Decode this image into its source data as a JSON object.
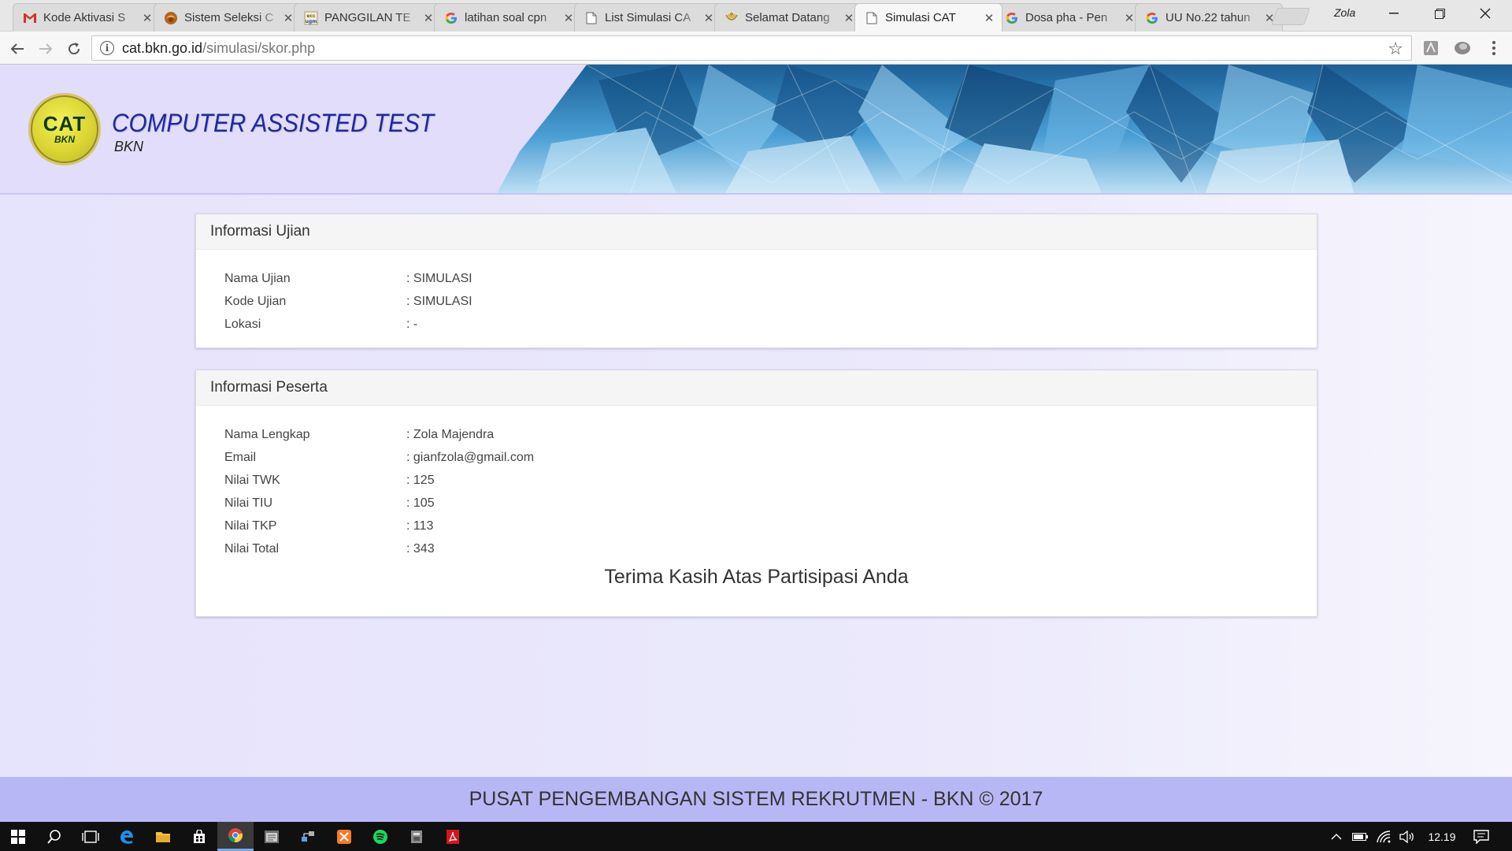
{
  "browser": {
    "tabs": [
      {
        "title": "Kode Aktivasi S",
        "icon": "gmail-icon",
        "active": false
      },
      {
        "title": "Sistem Seleksi C",
        "icon": "garuda-icon",
        "active": false
      },
      {
        "title": "PANGGILAN TE",
        "icon": "ugm-icon",
        "active": false
      },
      {
        "title": "latihan soal cpn",
        "icon": "google-icon",
        "active": false
      },
      {
        "title": "List Simulasi CA",
        "icon": "page-icon",
        "active": false
      },
      {
        "title": "Selamat Datang",
        "icon": "bkn-icon",
        "active": false
      },
      {
        "title": "Simulasi CAT",
        "icon": "page-icon",
        "active": true
      },
      {
        "title": "Dosa pha - Pen",
        "icon": "google-icon",
        "active": false
      },
      {
        "title": "UU No.22 tahun",
        "icon": "google-icon",
        "active": false
      }
    ],
    "profile_name": "Zola",
    "url_domain": "cat.bkn.go.id",
    "url_path": "/simulasi/skor.php"
  },
  "header": {
    "logo_text": "CAT",
    "logo_subtext": "BKN",
    "title": "COMPUTER ASSISTED TEST",
    "subtitle": "BKN"
  },
  "exam_info": {
    "heading": "Informasi Ujian",
    "rows": [
      {
        "label": "Nama Ujian",
        "value": ": SIMULASI"
      },
      {
        "label": "Kode Ujian",
        "value": ": SIMULASI"
      },
      {
        "label": "Lokasi",
        "value": ": -"
      }
    ]
  },
  "participant_info": {
    "heading": "Informasi Peserta",
    "rows": [
      {
        "label": "Nama Lengkap",
        "value": ": Zola Majendra"
      },
      {
        "label": "Email",
        "value": ": gianfzola@gmail.com"
      },
      {
        "label": "Nilai TWK",
        "value": ": 125"
      },
      {
        "label": "Nilai TIU",
        "value": ": 105"
      },
      {
        "label": "Nilai TKP",
        "value": ": 113"
      },
      {
        "label": "Nilai Total",
        "value": ": 343"
      }
    ],
    "thanks": "Terima Kasih Atas Partisipasi Anda"
  },
  "footer": {
    "text": "PUSAT PENGEMBANGAN SISTEM REKRUTMEN - BKN © 2017"
  },
  "taskbar": {
    "clock": "12.19",
    "apps": [
      "start-icon",
      "search-icon",
      "task-view-icon",
      "edge-icon",
      "file-explorer-icon",
      "store-icon",
      "chrome-icon",
      "notepad-icon",
      "network-tool-icon",
      "xampp-icon",
      "spotify-icon",
      "app-icon",
      "acrobat-icon"
    ]
  },
  "colors": {
    "page_bg": "#e8e6fb",
    "brand_blue": "#1f2a9a",
    "footer_bg": "#b8b7f5",
    "taskbar_bg": "#101010"
  }
}
